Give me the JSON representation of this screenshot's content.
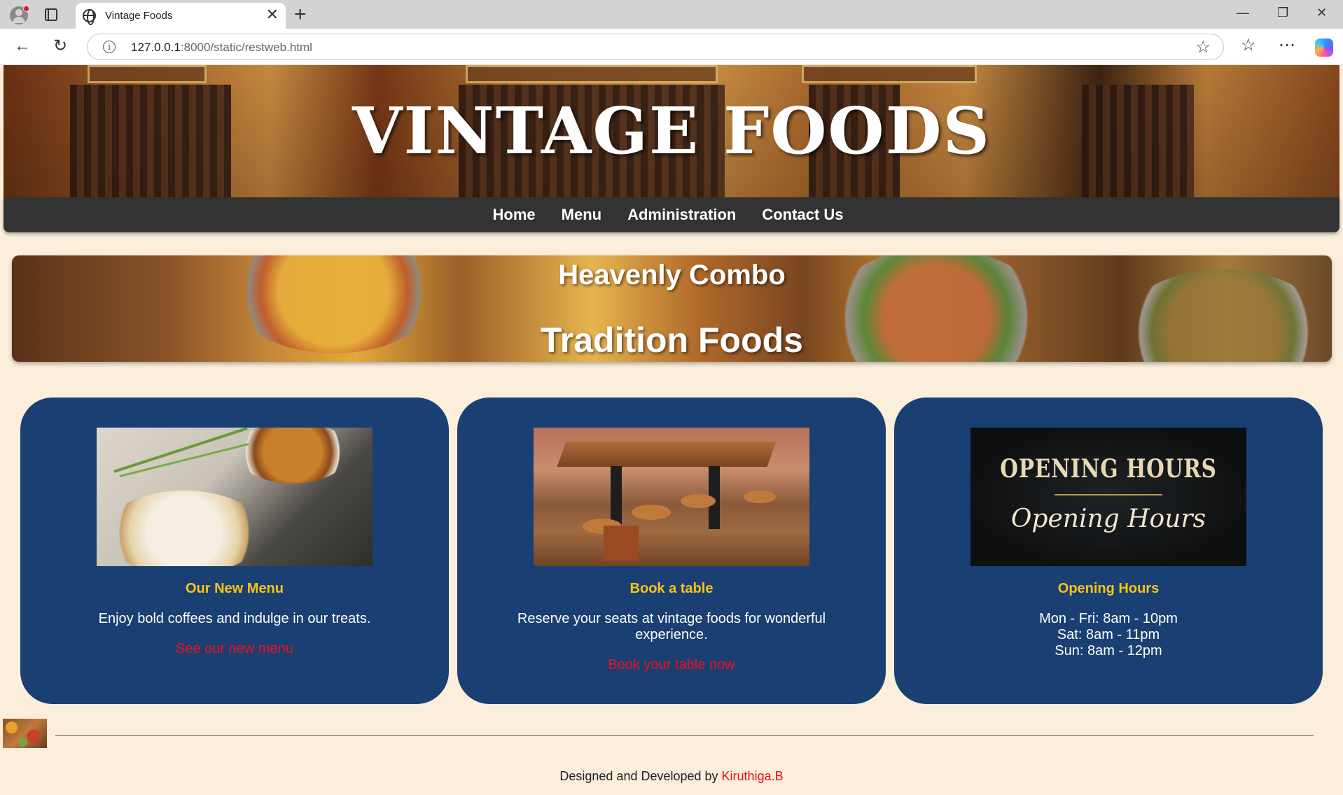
{
  "browser": {
    "tab_title": "Vintage Foods",
    "url_host": "127.0.0.1",
    "url_rest": ":8000/static/restweb.html",
    "icons": [
      "profile-icon",
      "tabs-icon",
      "globe-icon",
      "close-icon",
      "new-tab-icon",
      "minimize-icon",
      "restore-icon",
      "window-close-icon",
      "back-icon",
      "refresh-icon",
      "info-icon",
      "star-icon",
      "favorites-icon",
      "more-icon",
      "copilot-icon"
    ]
  },
  "hero": {
    "title": "VINTAGE FOODS"
  },
  "nav": {
    "items": [
      "Home",
      "Menu",
      "Administration",
      "Contact Us"
    ]
  },
  "banner": {
    "line1": "Heavenly Combo",
    "line2": "Tradition Foods"
  },
  "cards": [
    {
      "title": "Our New Menu",
      "text": "Enjoy bold coffees and indulge in our treats.",
      "link": "See our new menu",
      "image_alt": "appam-with-curry-image"
    },
    {
      "title": "Book a table",
      "text": "Reserve your seats at vintage foods for wonderful experience.",
      "link": "Book your table now",
      "image_alt": "wooden-table-with-stools-image"
    },
    {
      "title": "Opening Hours",
      "lines": [
        "Mon - Fri: 8am - 10pm",
        "Sat: 8am - 11pm",
        "Sun: 8am - 12pm"
      ],
      "image_text_1": "OPENING HOURS",
      "image_text_2": "Opening Hours"
    }
  ],
  "footer": {
    "prefix": "Designed and Developed by ",
    "author": "Kiruthiga.B"
  },
  "colors": {
    "page_bg": "#fbeedb",
    "nav_bg": "#333333",
    "card_bg": "#1a3f73",
    "card_title": "#f8c41a",
    "link": "#f20e1a"
  }
}
